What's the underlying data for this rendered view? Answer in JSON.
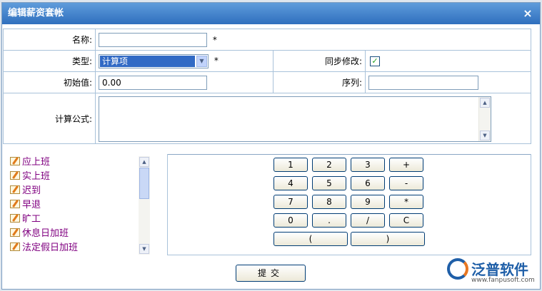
{
  "dialog": {
    "title": "编辑薪资套帐",
    "close_glyph": "×"
  },
  "form": {
    "name_label": "名称:",
    "name_value": "",
    "required_mark": "*",
    "type_label": "类型:",
    "type_value": "计算项",
    "sync_label": "同步修改:",
    "sync_checked": true,
    "sync_glyph": "✓",
    "initial_label": "初始值:",
    "initial_value": "0.00",
    "order_label": "序列:",
    "order_value": "",
    "formula_label": "计算公式:"
  },
  "items": [
    "应上班",
    "实上班",
    "迟到",
    "早退",
    "旷工",
    "休息日加班",
    "法定假日加班"
  ],
  "keypad": {
    "row1": [
      "1",
      "2",
      "3",
      "+"
    ],
    "row2": [
      "4",
      "5",
      "6",
      "-"
    ],
    "row3": [
      "7",
      "8",
      "9",
      "*"
    ],
    "row4": [
      "0",
      ".",
      "/",
      "C"
    ],
    "row5": [
      "(",
      ")"
    ]
  },
  "submit_label": "提交",
  "branding": {
    "name": "泛普软件",
    "url": "www.fanpusoft.com"
  },
  "icons": {
    "close": "close-icon",
    "dropdown": "chevron-down-icon",
    "item": "edit-pencil-icon",
    "logo": "fanpu-logo"
  }
}
